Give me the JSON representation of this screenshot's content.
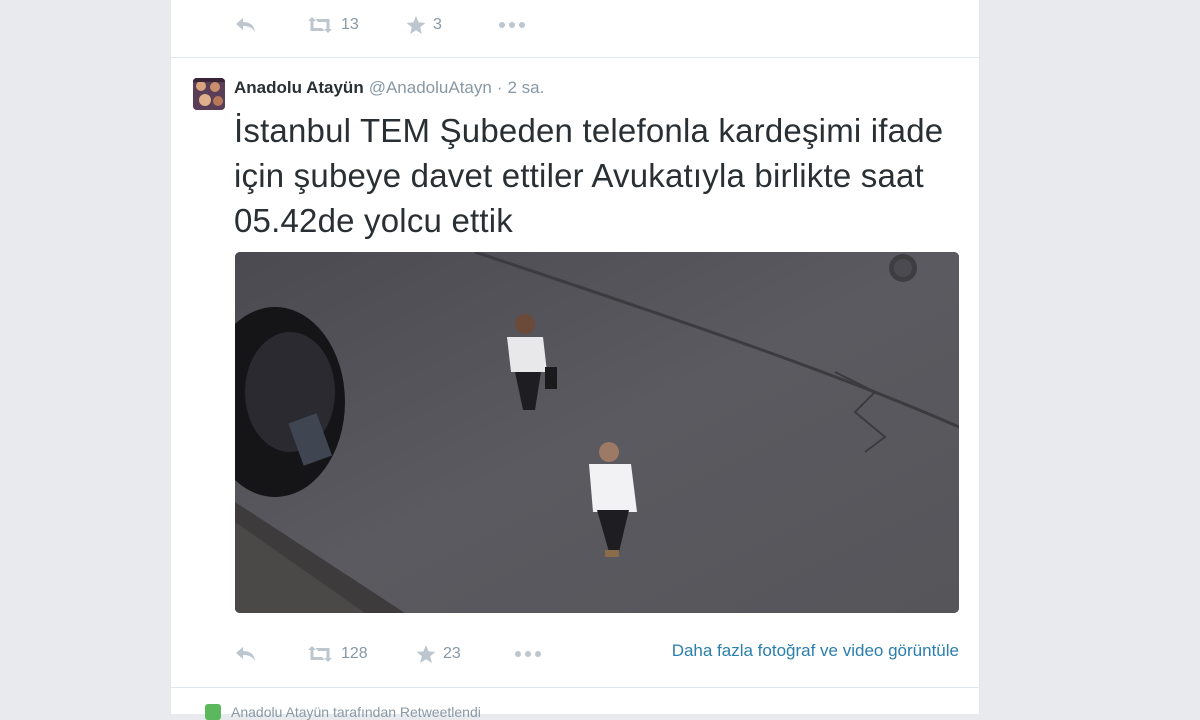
{
  "top_tweet": {
    "retweet_count": "13",
    "favorite_count": "3"
  },
  "tweet": {
    "author_name": "Anadolu Atayün",
    "author_handle": "@AnadoluAtayn",
    "separator": "·",
    "time": "2 sa.",
    "text": "İstanbul TEM Şubeden telefonla kardeşimi ifade için şubeye davet ettiler Avukatıyla birlikte saat 05.42de yolcu ettik",
    "retweet_count": "128",
    "favorite_count": "23",
    "more_media_link": "Daha fazla fotoğraf ve video görüntüle"
  },
  "next_tweet": {
    "context": "Anadolu Atayün tarafından Retweetlendi"
  },
  "icons": {
    "reply": "reply-icon",
    "retweet": "retweet-icon",
    "favorite": "star-icon",
    "more": "more-dots-icon"
  },
  "colors": {
    "link": "#2a7fad",
    "muted": "#8899a6",
    "text": "#292f33",
    "background": "#e8eaed"
  }
}
